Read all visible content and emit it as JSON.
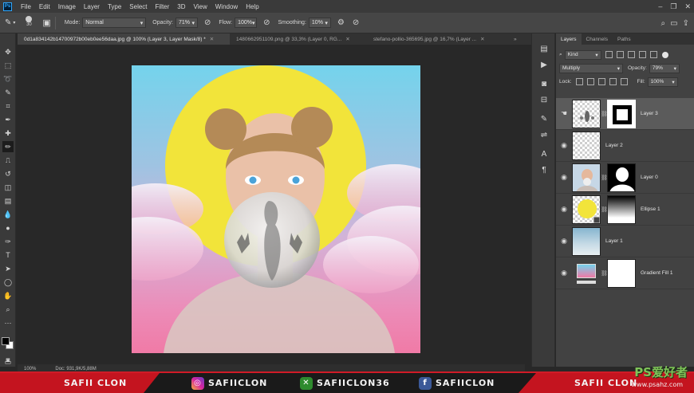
{
  "menu": [
    "File",
    "Edit",
    "Image",
    "Layer",
    "Type",
    "Select",
    "Filter",
    "3D",
    "View",
    "Window",
    "Help"
  ],
  "options": {
    "brush_size": "30",
    "mode_label": "Mode:",
    "mode_value": "Normal",
    "opacity_label": "Opacity:",
    "opacity_value": "71%",
    "flow_label": "Flow:",
    "flow_value": "100%",
    "smoothing_label": "Smoothing:",
    "smoothing_value": "10%"
  },
  "tabs": [
    {
      "label": "0d1a834142b14700972b00eb0ee56daa.jpg @ 100% (Layer 3, Layer Mask/8) *",
      "active": true
    },
    {
      "label": "1480662951109.png @ 33,3% (Layer 0, RG...",
      "active": false
    },
    {
      "label": "stefano-pollio-365695.jpg @ 16,7% (Layer ...",
      "active": false
    }
  ],
  "status": {
    "zoom": "100%",
    "doc": "Doc: 931,9K/5,88M"
  },
  "panel": {
    "tabs": [
      "Layers",
      "Channels",
      "Paths"
    ],
    "filter_value": "Kind",
    "blend_value": "Multiply",
    "opacity_label": "Opacity:",
    "opacity_value": "79%",
    "lock_label": "Lock:",
    "fill_label": "Fill:",
    "fill_value": "100%"
  },
  "layers": [
    {
      "name": "Layer 3",
      "selected": true
    },
    {
      "name": "Layer 2",
      "selected": false
    },
    {
      "name": "Layer 0",
      "selected": false
    },
    {
      "name": "Ellipse 1",
      "selected": false
    },
    {
      "name": "Layer 1",
      "selected": false
    },
    {
      "name": "Gradient Fill 1",
      "selected": false
    }
  ],
  "banner": {
    "left": "SAFII CLON",
    "instagram": "SAFIICLON",
    "other": "SAFIICLON36",
    "facebook": "SAFIICLON",
    "right": "SAFII CLON"
  },
  "watermark": {
    "logo": "PS爱好者",
    "site": "www.psahz.com"
  },
  "colors": {
    "accent": "#c4141f",
    "artwork_sun": "#f2e43a",
    "watermark": "#7fc35a"
  }
}
